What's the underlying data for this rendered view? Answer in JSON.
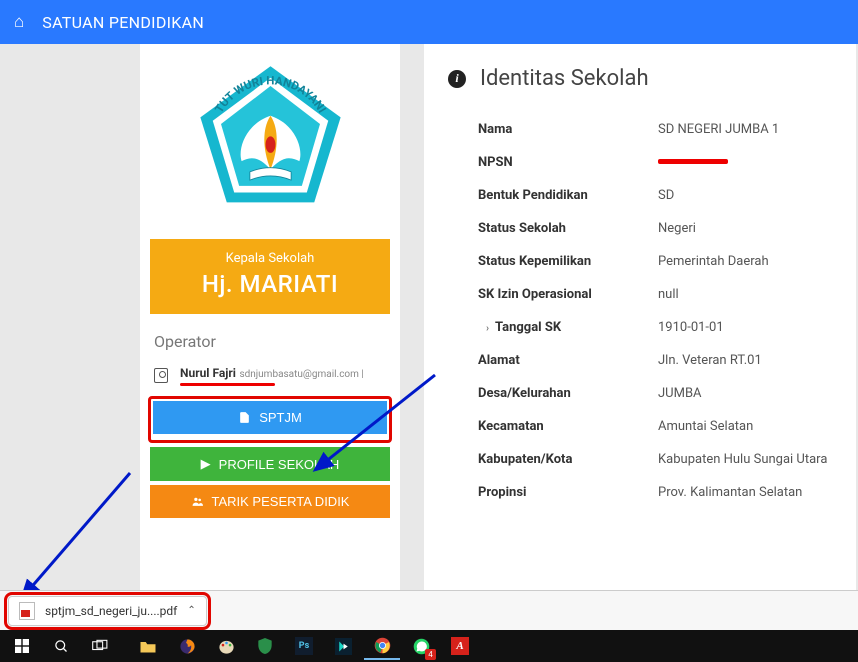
{
  "header": {
    "title": "SATUAN PENDIDIKAN"
  },
  "school_logo": {
    "motto": "TUT WURI HANDAYANI"
  },
  "head_teacher": {
    "label": "Kepala Sekolah",
    "name": "Hj. MARIATI"
  },
  "operator": {
    "section_label": "Operator",
    "name": "Nurul Fajri",
    "email": "sdnjumbasatu@gmail.com |"
  },
  "buttons": {
    "sptjm": "SPTJM",
    "profile": "PROFILE SEKOLAH",
    "tarik": "TARIK PESERTA DIDIK"
  },
  "identity": {
    "section_title": "Identitas Sekolah",
    "rows": [
      {
        "key": "Nama",
        "val": "SD NEGERI JUMBA 1"
      },
      {
        "key": "NPSN",
        "val": "",
        "redacted": true
      },
      {
        "key": "Bentuk Pendidikan",
        "val": "SD"
      },
      {
        "key": "Status Sekolah",
        "val": "Negeri"
      },
      {
        "key": "Status Kepemilikan",
        "val": "Pemerintah Daerah"
      },
      {
        "key": "SK Izin Operasional",
        "val": "null"
      },
      {
        "key": "Tanggal SK",
        "val": "1910-01-01",
        "indent": true
      },
      {
        "key": "Alamat",
        "val": "Jln. Veteran RT.01"
      },
      {
        "key": "Desa/Kelurahan",
        "val": "JUMBA"
      },
      {
        "key": "Kecamatan",
        "val": "Amuntai Selatan"
      },
      {
        "key": "Kabupaten/Kota",
        "val": "Kabupaten Hulu Sungai Utara"
      },
      {
        "key": "Propinsi",
        "val": "Prov. Kalimantan Selatan"
      }
    ]
  },
  "download": {
    "filename": "sptjm_sd_negeri_ju....pdf"
  }
}
